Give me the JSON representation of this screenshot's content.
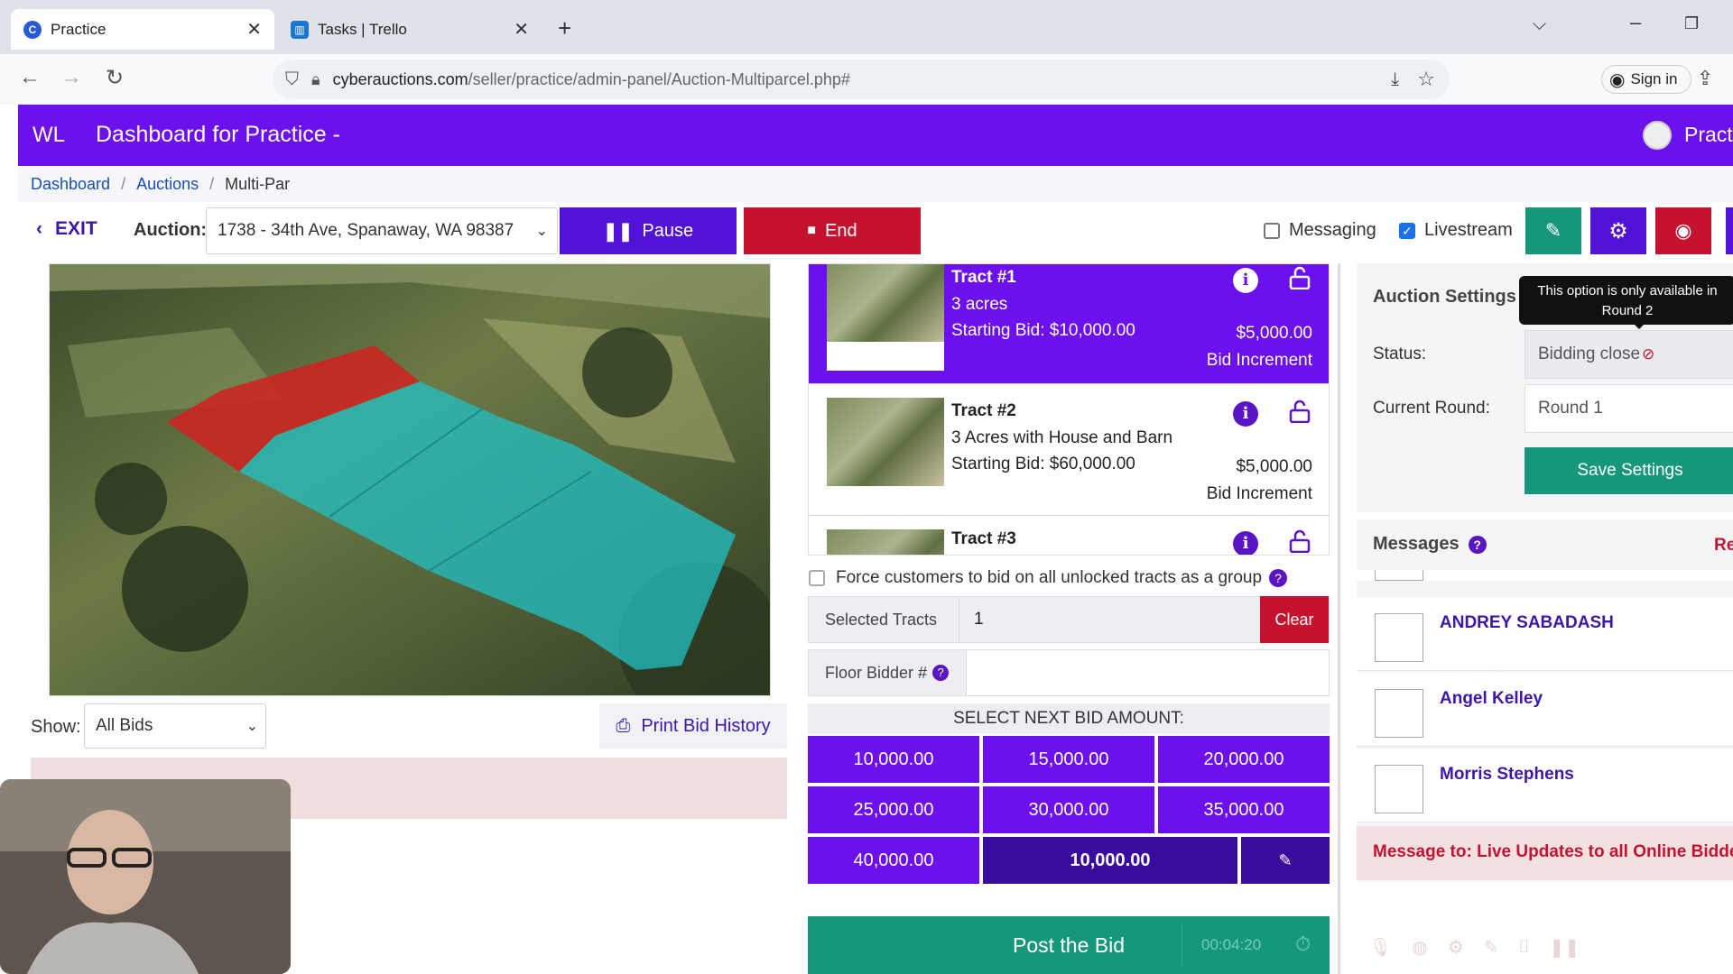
{
  "browser": {
    "tabs": [
      {
        "title": "Practice",
        "icon": "cyberauctions-favicon"
      },
      {
        "title": "Tasks | Trello",
        "icon": "trello-favicon"
      }
    ],
    "url_host": "cyberauctions.com",
    "url_path": "/seller/practice/admin-panel/Auction-Multiparcel.php#",
    "sign_in": "Sign in"
  },
  "header": {
    "logo": "WL",
    "title": "Dashboard for Practice -",
    "user": "Practi"
  },
  "breadcrumb": {
    "items": [
      "Dashboard",
      "Auctions",
      "Multi-Par"
    ],
    "sep": "/"
  },
  "toolbar": {
    "exit": "EXIT",
    "auction_label": "Auction:",
    "auction_value": "1738 - 34th Ave, Spanaway, WA 98387",
    "pause": "Pause",
    "end": "End",
    "messaging": "Messaging",
    "livestream": "Livestream"
  },
  "left": {
    "show_label": "Show:",
    "show_value": "All Bids",
    "print": "Print Bid History"
  },
  "tracts": [
    {
      "name": "Tract #1",
      "desc": "3 acres",
      "start": "Starting Bid: $10,000.00",
      "increment": "$5,000.00",
      "inc_label": "Bid Increment"
    },
    {
      "name": "Tract #2",
      "desc": "3 Acres with House and Barn",
      "start": "Starting Bid: $60,000.00",
      "increment": "$5,000.00",
      "inc_label": "Bid Increment"
    },
    {
      "name": "Tract #3"
    }
  ],
  "bidding": {
    "force_group": "Force customers to bid on all unlocked tracts as a group",
    "selected_label": "Selected Tracts",
    "selected_value": "1",
    "clear": "Clear",
    "floor_label": "Floor Bidder #",
    "select_next": "SELECT NEXT BID AMOUNT:",
    "amounts": [
      "10,000.00",
      "15,000.00",
      "20,000.00",
      "25,000.00",
      "30,000.00",
      "35,000.00",
      "40,000.00"
    ],
    "custom_amount": "10,000.00",
    "post": "Post the Bid",
    "timer": "00:04:20"
  },
  "settings": {
    "title": "Auction Settings",
    "tooltip": "This option is only available in Round 2",
    "status_label": "Status:",
    "status_value": "Bidding close",
    "round_label": "Current Round:",
    "round_value": "Round 1",
    "save": "Save Settings"
  },
  "messages": {
    "title": "Messages",
    "right_label": "Re",
    "people": [
      "ANDREY SABADASH",
      "Angel Kelley",
      "Morris Stephens"
    ],
    "footer": "Message to: Live Updates to all Online Bidders"
  },
  "colors": {
    "purple": "#6c11ed",
    "red": "#c4122f",
    "teal": "#17977a"
  }
}
